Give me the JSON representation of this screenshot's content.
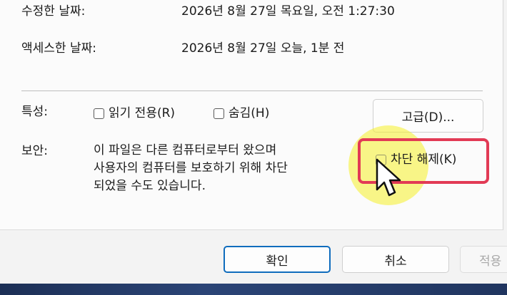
{
  "properties": {
    "modified_label": "수정한 날짜:",
    "modified_value": "2026년 8월 27일 목요일, 오전 1:27:30",
    "accessed_label": "액세스한 날짜:",
    "accessed_value": "2026년 8월 27일 오늘, 1분 전"
  },
  "attributes": {
    "label": "특성:",
    "readonly_label": "읽기 전용(R)",
    "readonly_checked": false,
    "hidden_label": "숨김(H)",
    "hidden_checked": false,
    "advanced_button": "고급(D)..."
  },
  "security": {
    "label": "보안:",
    "line1": "이 파일은 다른 컴퓨터로부터 왔으며",
    "line2": "사용자의 컴퓨터를 보호하기 위해 차단",
    "line3": "되었을 수도 있습니다.",
    "unblock_label": "차단 해제(K)",
    "unblock_checked": false
  },
  "footer": {
    "ok_button": "확인",
    "cancel_button": "취소",
    "apply_button": "적용"
  },
  "colors": {
    "highlight_frame": "#e23a55",
    "highlight_spot": "#f5f028",
    "primary_border": "#0f6cbd"
  }
}
